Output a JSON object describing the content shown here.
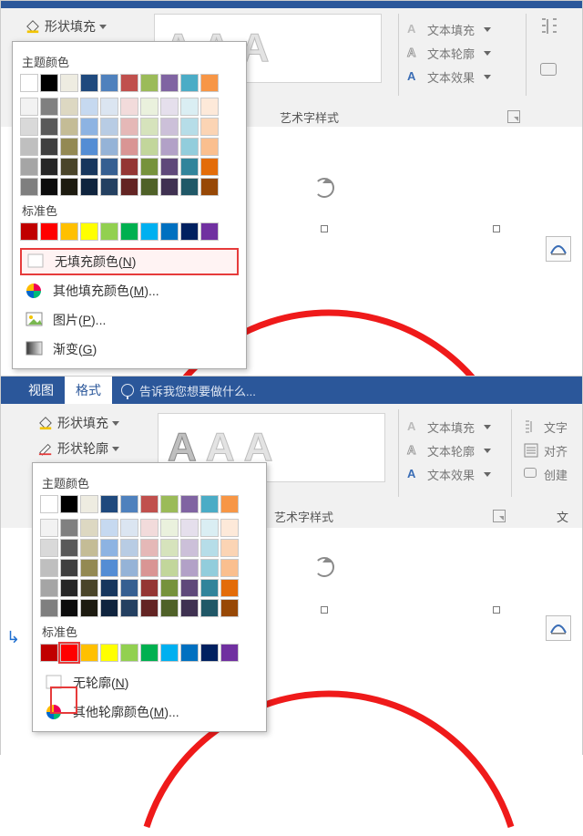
{
  "top": {
    "fill_label": "形状填充",
    "popup": {
      "theme_title": "主题颜色",
      "theme_row": [
        "#ffffff",
        "#000000",
        "#eeece1",
        "#1f497d",
        "#4f81bd",
        "#c0504d",
        "#9bbb59",
        "#8064a2",
        "#4bacc6",
        "#f79646"
      ],
      "theme_shades": [
        [
          "#f2f2f2",
          "#808080",
          "#ddd8c2",
          "#c6d9f0",
          "#dbe5f1",
          "#f2dbdb",
          "#eaf1dd",
          "#e5dfec",
          "#daeef3",
          "#fde9d9"
        ],
        [
          "#d9d9d9",
          "#595959",
          "#c4bc96",
          "#8db3e2",
          "#b8cce4",
          "#e5b8b7",
          "#d6e3bc",
          "#ccc0d9",
          "#b6dde8",
          "#fbd4b4"
        ],
        [
          "#bfbfbf",
          "#3f3f3f",
          "#938953",
          "#548dd4",
          "#95b3d7",
          "#d99594",
          "#c2d69b",
          "#b2a1c7",
          "#92cddc",
          "#fabf8f"
        ],
        [
          "#a5a5a5",
          "#262626",
          "#494429",
          "#17365d",
          "#365f91",
          "#943634",
          "#76923c",
          "#5f497a",
          "#31849b",
          "#e36c09"
        ],
        [
          "#7f7f7f",
          "#0c0c0c",
          "#1d1b10",
          "#0f243e",
          "#244061",
          "#632423",
          "#4f6128",
          "#3f3151",
          "#205867",
          "#974806"
        ]
      ],
      "standard_title": "标准色",
      "standard": [
        "#c00000",
        "#ff0000",
        "#ffc000",
        "#ffff00",
        "#92d050",
        "#00b050",
        "#00b0f0",
        "#0070c0",
        "#002060",
        "#7030a0"
      ],
      "no_fill": "无填充颜色(",
      "no_fill_ul": "N",
      "no_fill_end": ")",
      "more": "其他填充颜色(",
      "more_ul": "M",
      "more_end": ")...",
      "picture": "图片(",
      "picture_ul": "P",
      "picture_end": ")...",
      "gradient": "渐变(",
      "gradient_ul": "G",
      "gradient_end": ")"
    },
    "side": {
      "text_fill": "文本填充",
      "text_outline": "文本轮廓",
      "text_effects": "文本效果"
    },
    "group_label": "艺术字样式"
  },
  "bottom": {
    "tab_view": "视图",
    "tab_format": "格式",
    "tell_me": "告诉我您想要做什么...",
    "fill_label": "形状填充",
    "outline_label": "形状轮廓",
    "side": {
      "text_fill": "文本填充",
      "text_outline": "文本轮廓",
      "text_effects": "文本效果",
      "text_extra": "文字",
      "align": "对齐",
      "create": "创建"
    },
    "group_label": "艺术字样式",
    "group_label2": "文",
    "popup": {
      "theme_title": "主题颜色",
      "theme_row": [
        "#ffffff",
        "#000000",
        "#eeece1",
        "#1f497d",
        "#4f81bd",
        "#c0504d",
        "#9bbb59",
        "#8064a2",
        "#4bacc6",
        "#f79646"
      ],
      "theme_shades": [
        [
          "#f2f2f2",
          "#808080",
          "#ddd8c2",
          "#c6d9f0",
          "#dbe5f1",
          "#f2dbdb",
          "#eaf1dd",
          "#e5dfec",
          "#daeef3",
          "#fde9d9"
        ],
        [
          "#d9d9d9",
          "#595959",
          "#c4bc96",
          "#8db3e2",
          "#b8cce4",
          "#e5b8b7",
          "#d6e3bc",
          "#ccc0d9",
          "#b6dde8",
          "#fbd4b4"
        ],
        [
          "#bfbfbf",
          "#3f3f3f",
          "#938953",
          "#548dd4",
          "#95b3d7",
          "#d99594",
          "#c2d69b",
          "#b2a1c7",
          "#92cddc",
          "#fabf8f"
        ],
        [
          "#a5a5a5",
          "#262626",
          "#494429",
          "#17365d",
          "#365f91",
          "#943634",
          "#76923c",
          "#5f497a",
          "#31849b",
          "#e36c09"
        ],
        [
          "#7f7f7f",
          "#0c0c0c",
          "#1d1b10",
          "#0f243e",
          "#244061",
          "#632423",
          "#4f6128",
          "#3f3151",
          "#205867",
          "#974806"
        ]
      ],
      "standard_title": "标准色",
      "standard": [
        "#c00000",
        "#ff0000",
        "#ffc000",
        "#ffff00",
        "#92d050",
        "#00b050",
        "#00b0f0",
        "#0070c0",
        "#002060",
        "#7030a0"
      ],
      "no_outline": "无轮廓(",
      "no_outline_ul": "N",
      "no_outline_end": ")",
      "more": "其他轮廓颜色(",
      "more_ul": "M",
      "more_end": ")..."
    }
  },
  "colors": {
    "accent_red": "#e63b3b",
    "ms_blue": "#2b579a"
  }
}
